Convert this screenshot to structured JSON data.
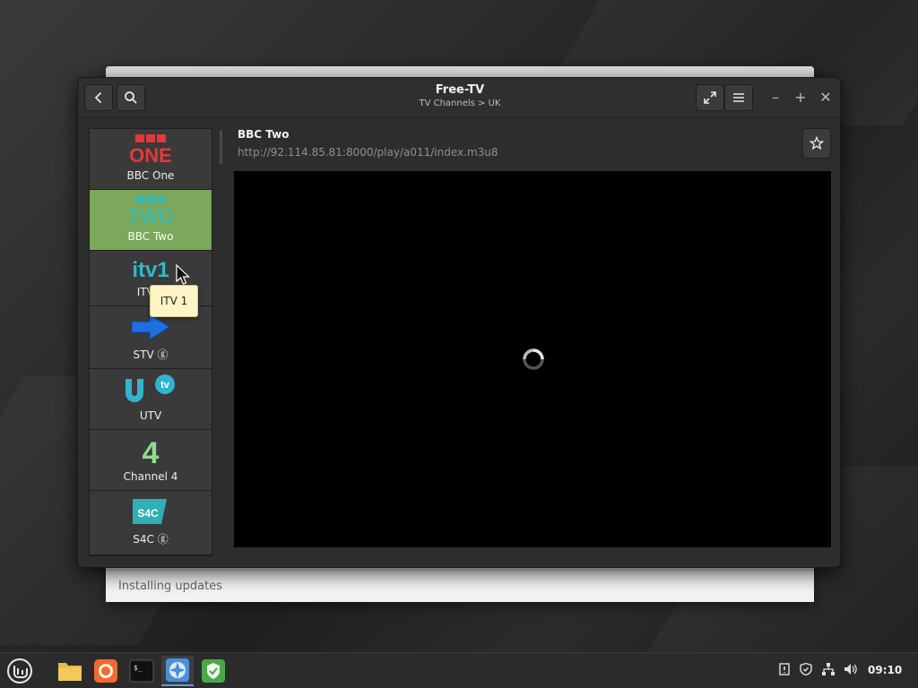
{
  "window": {
    "title": "Free-TV",
    "subtitle": "TV Channels > UK"
  },
  "background_window": {
    "status": "Installing updates"
  },
  "channels": [
    {
      "name": "BBC One",
      "logo": "ONE",
      "logo_color": "#e5383b",
      "selected": false
    },
    {
      "name": "BBC Two",
      "logo": "TWO",
      "logo_color": "#3fb6a8",
      "selected": true
    },
    {
      "name": "ITV 1",
      "logo": "itv1",
      "logo_color": "#2fb9c8",
      "selected": false
    },
    {
      "name": "STV ⓖ",
      "logo": "stv-arrow",
      "logo_color": "#1f6fe0",
      "selected": false
    },
    {
      "name": "UTV",
      "logo": "utv",
      "logo_color": "#30b4cf",
      "selected": false
    },
    {
      "name": "Channel 4",
      "logo": "4",
      "logo_color": "#8fdc8a",
      "selected": false
    },
    {
      "name": "S4C ⓖ",
      "logo": "S4C",
      "logo_color": "#2fb0b5",
      "selected": false
    }
  ],
  "current": {
    "title": "BBC Two",
    "url": "http://92.114.85.81:8000/play/a011/index.m3u8"
  },
  "tooltip": {
    "text": "ITV 1"
  },
  "taskbar": {
    "clock": "09:10"
  },
  "colors": {
    "selected_bg": "#7ba85a",
    "accent": "#5aa0e0"
  }
}
